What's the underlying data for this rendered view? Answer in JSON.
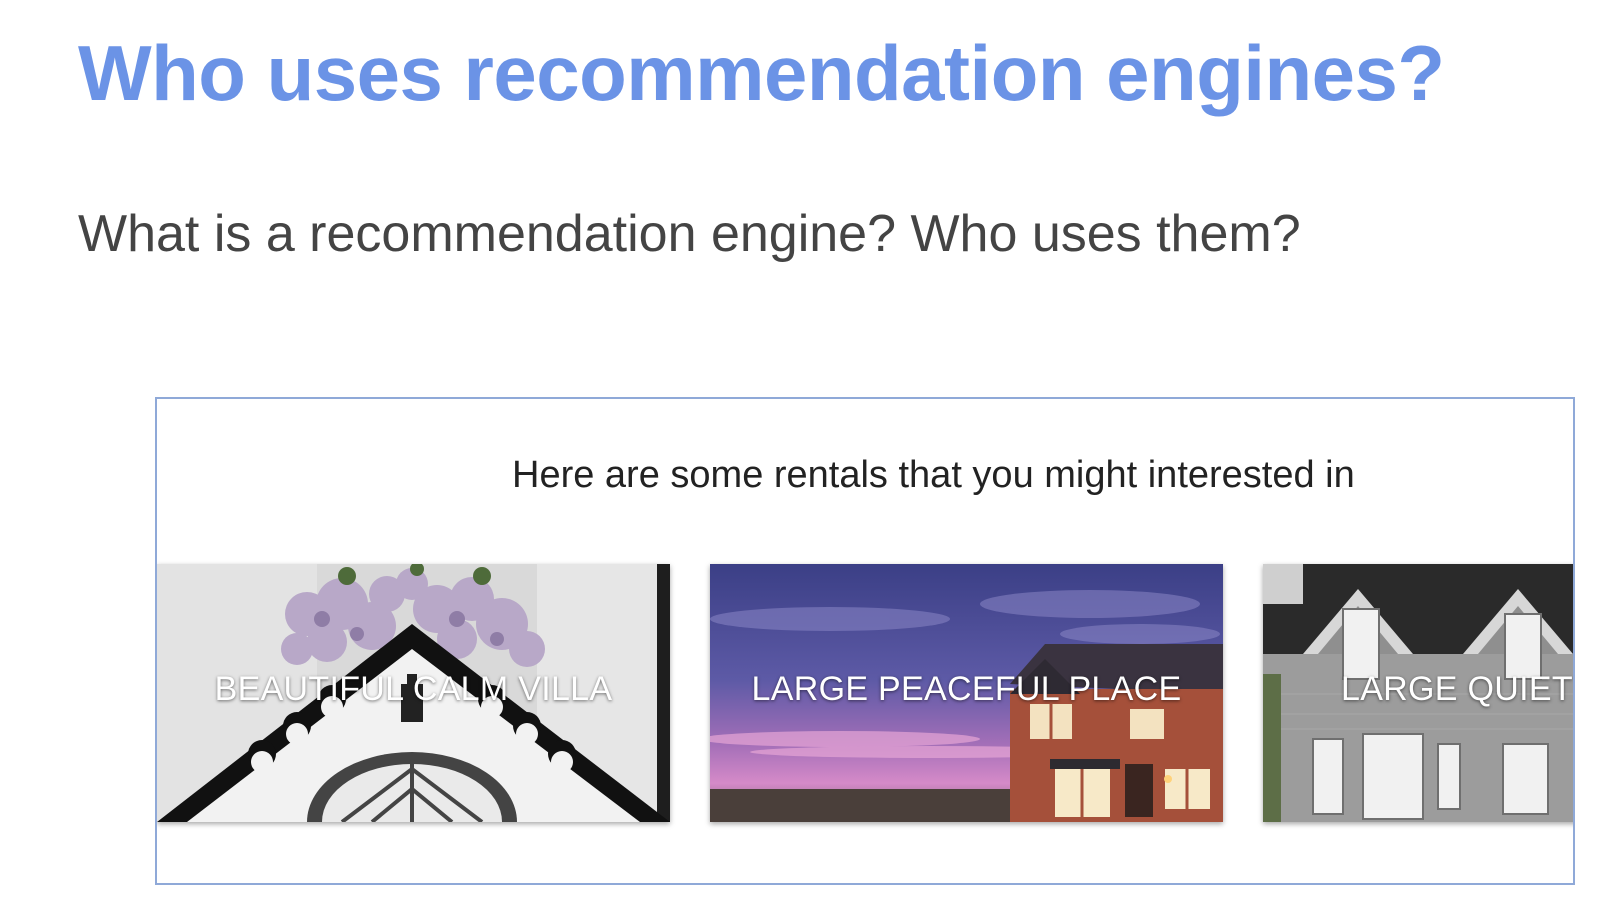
{
  "slide": {
    "title": "Who uses recommendation engines?",
    "subtitle": "What is a recommendation engine? Who uses them?"
  },
  "rentals": {
    "heading": "Here are some rentals that you might interested in",
    "cards": [
      {
        "label": "BEAUTIFUL CALM VILLA",
        "image": "white-villa-gable-photo"
      },
      {
        "label": "LARGE PEACEFUL PLACE",
        "image": "brick-house-at-dusk-photo"
      },
      {
        "label": "LARGE QUIET",
        "image": "stone-house-facade-photo"
      }
    ]
  },
  "colors": {
    "title": "#6b93e6",
    "subtitle": "#444444",
    "frame_border": "#8fa9d8"
  }
}
